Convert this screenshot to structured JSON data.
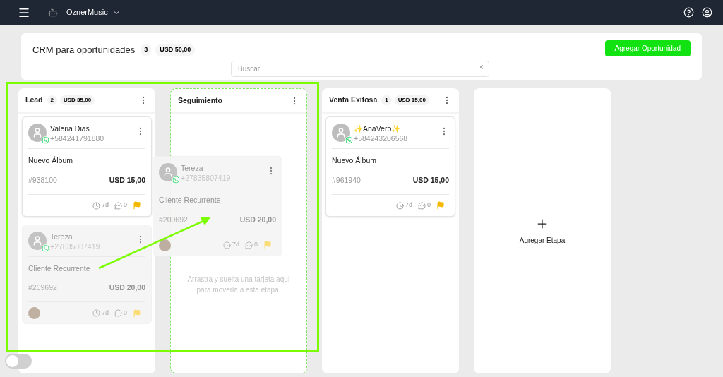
{
  "top_bar": {
    "workspace": "OznerMusic"
  },
  "header": {
    "title": "CRM para oportunidades",
    "count": "3",
    "total": "USD 50,00",
    "add_button": "Agregar Oportunidad",
    "search": {
      "placeholder": "Buscar"
    }
  },
  "columns": [
    {
      "name": "Lead",
      "count": "2",
      "total": "USD 35,00",
      "drop_target": false,
      "cards": [
        {
          "name": "Valeria Dias",
          "phone": "+584241791880",
          "title": "Nuevo Álbum",
          "code": "#938100",
          "amount": "USD 15,00",
          "age": "7d",
          "comments": "0",
          "has_photo": false,
          "faded": false
        },
        {
          "name": "Tereza",
          "phone": "+27835807419",
          "title": "Cliente Recurrente",
          "code": "#209692",
          "amount": "USD 20,00",
          "age": "7d",
          "comments": "0",
          "has_photo": true,
          "faded": true
        }
      ]
    },
    {
      "name": "Seguimiento",
      "drop_target": true,
      "hint": "Arrastra y suelta una tarjeta aquí para moverla a esta etapa."
    },
    {
      "name": "Venta Exitosa",
      "count": "1",
      "total": "USD 15,00",
      "drop_target": false,
      "cards": [
        {
          "name": "✨AnaVero✨",
          "phone": "+584243206568",
          "title": "Nuevo Álbum",
          "code": "#961940",
          "amount": "USD 15,00",
          "age": "7d",
          "comments": "0",
          "has_photo": false,
          "faded": false
        }
      ]
    }
  ],
  "add_stage": "Agregar Etapa",
  "drag_preview": {
    "name": "Tereza",
    "phone": "+27835807419",
    "title": "Cliente Recurrente",
    "code": "#209692",
    "amount": "USD 20,00",
    "age": "7d",
    "comments": "0",
    "has_photo": true
  },
  "toggle": {
    "on": false
  }
}
